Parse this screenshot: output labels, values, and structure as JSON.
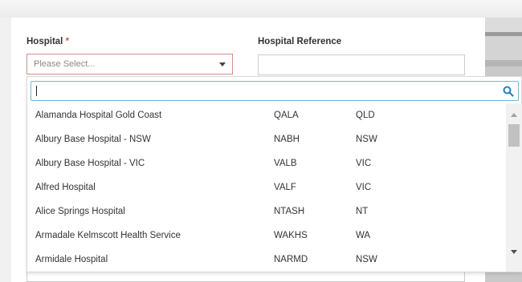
{
  "form": {
    "hospital_label": "Hospital",
    "required_marker": "*",
    "hospital_reference_label": "Hospital Reference",
    "select_placeholder": "Please Select...",
    "hospital_reference_value": ""
  },
  "dropdown": {
    "search_value": "",
    "search_icon": "search-icon",
    "items": [
      {
        "name": "Alamanda Hospital Gold Coast",
        "code": "QALA",
        "state": "QLD"
      },
      {
        "name": "Albury Base Hospital - NSW",
        "code": "NABH",
        "state": "NSW"
      },
      {
        "name": "Albury Base Hospital - VIC",
        "code": "VALB",
        "state": "VIC"
      },
      {
        "name": "Alfred Hospital",
        "code": "VALF",
        "state": "VIC"
      },
      {
        "name": "Alice Springs Hospital",
        "code": "NTASH",
        "state": "NT"
      },
      {
        "name": "Armadale Kelmscott Health Service",
        "code": "WAKHS",
        "state": "WA"
      },
      {
        "name": "Armidale Hospital",
        "code": "NARMD",
        "state": "NSW"
      }
    ]
  },
  "colors": {
    "required": "#d9534f",
    "select_border_error": "#d88a8a",
    "search_border_focus": "#76b5d6",
    "search_icon": "#2a7fb8"
  }
}
